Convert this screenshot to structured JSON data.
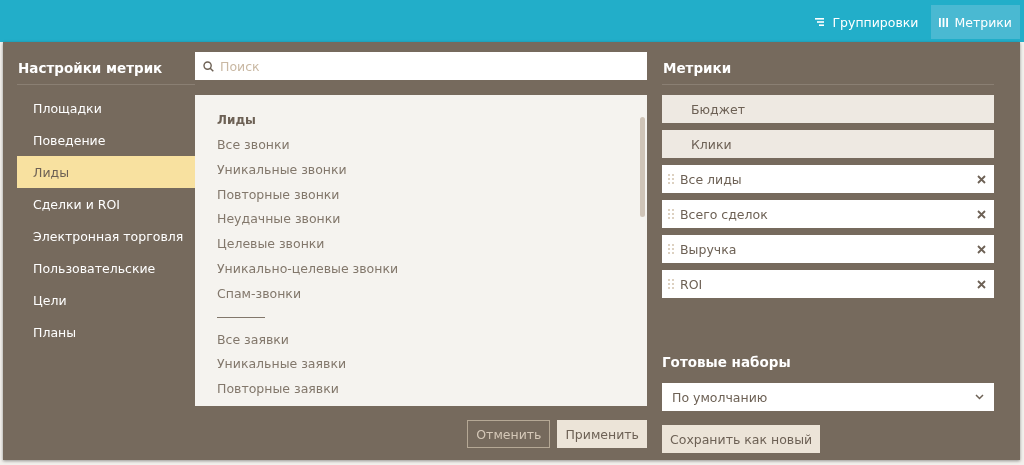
{
  "toolbar": {
    "buttons": [
      {
        "label": "Группировки",
        "kind": "groupings",
        "selected": false
      },
      {
        "label": "Метрики",
        "kind": "metrics",
        "selected": true
      }
    ]
  },
  "panel": {
    "title": "Настройки метрик",
    "search": {
      "placeholder": "Поиск"
    },
    "categories": [
      {
        "label": "Площадки",
        "selected": false
      },
      {
        "label": "Поведение",
        "selected": false
      },
      {
        "label": "Лиды",
        "selected": true
      },
      {
        "label": "Сделки и ROI",
        "selected": false
      },
      {
        "label": "Электронная торговля",
        "selected": false
      },
      {
        "label": "Пользовательские",
        "selected": false
      },
      {
        "label": "Цели",
        "selected": false
      },
      {
        "label": "Планы",
        "selected": false
      }
    ],
    "metric_list": [
      {
        "kind": "header",
        "label": "Лиды"
      },
      {
        "kind": "item",
        "label": "Все звонки"
      },
      {
        "kind": "item",
        "label": "Уникальные звонки"
      },
      {
        "kind": "item",
        "label": "Повторные звонки"
      },
      {
        "kind": "item",
        "label": "Неудачные звонки"
      },
      {
        "kind": "item",
        "label": "Целевые звонки"
      },
      {
        "kind": "item",
        "label": "Уникально-целевые звонки"
      },
      {
        "kind": "item",
        "label": "Спам-звонки"
      },
      {
        "kind": "separator"
      },
      {
        "kind": "item",
        "label": "Все заявки"
      },
      {
        "kind": "item",
        "label": "Уникальные заявки"
      },
      {
        "kind": "item",
        "label": "Повторные заявки"
      }
    ],
    "chosen_title": "Метрики",
    "chosen": [
      {
        "kind": "fixed",
        "label": "Бюджет"
      },
      {
        "kind": "fixed",
        "label": "Клики"
      },
      {
        "kind": "removable",
        "label": "Все лиды"
      },
      {
        "kind": "removable",
        "label": "Всего сделок"
      },
      {
        "kind": "removable",
        "label": "Выручка"
      },
      {
        "kind": "removable",
        "label": "ROI"
      }
    ],
    "presets_title": "Готовые наборы",
    "preset_select": {
      "value": "По умолчанию"
    },
    "buttons": [
      {
        "kind": "secondary",
        "label": "Отменить"
      },
      {
        "kind": "primary",
        "label": "Применить"
      },
      {
        "kind": "primary",
        "label": "Сохранить как новый"
      }
    ]
  }
}
